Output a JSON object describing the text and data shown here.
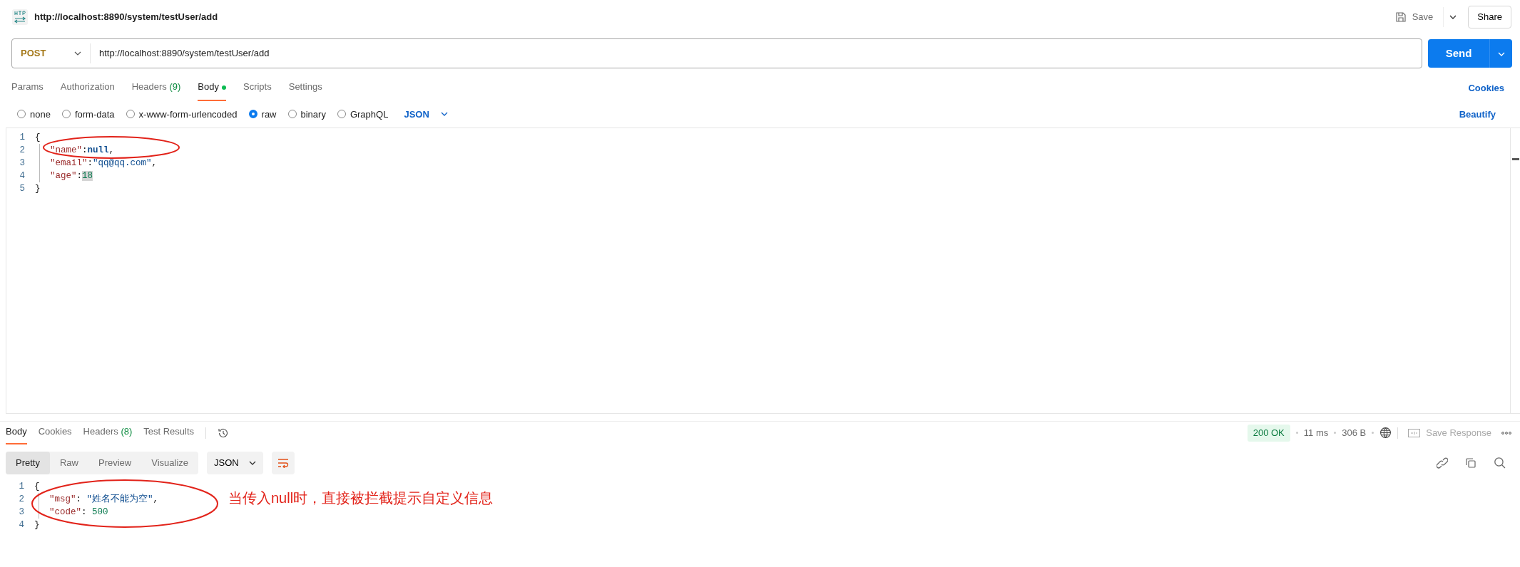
{
  "header": {
    "title": "http://localhost:8890/system/testUser/add",
    "save": "Save",
    "share": "Share"
  },
  "request": {
    "method": "POST",
    "url": "http://localhost:8890/system/testUser/add",
    "send": "Send"
  },
  "request_tabs": [
    {
      "label": "Params",
      "selected": false,
      "dot": false
    },
    {
      "label": "Authorization",
      "selected": false,
      "dot": false
    },
    {
      "label": "Headers",
      "count": "(9)",
      "selected": false,
      "dot": false
    },
    {
      "label": "Body",
      "selected": true,
      "dot": true
    },
    {
      "label": "Scripts",
      "selected": false,
      "dot": false
    },
    {
      "label": "Settings",
      "selected": false,
      "dot": false
    }
  ],
  "cookies_link": "Cookies",
  "body_types": [
    {
      "label": "none",
      "selected": false
    },
    {
      "label": "form-data",
      "selected": false
    },
    {
      "label": "x-www-form-urlencoded",
      "selected": false
    },
    {
      "label": "raw",
      "selected": true
    },
    {
      "label": "binary",
      "selected": false
    },
    {
      "label": "GraphQL",
      "selected": false
    }
  ],
  "raw_format": "JSON",
  "beautify": "Beautify",
  "request_body": [
    {
      "number": "1",
      "tokens": [
        {
          "kind": "punct",
          "text": "{"
        }
      ]
    },
    {
      "number": "2",
      "tokens": [
        {
          "kind": "key",
          "text": "\"name\""
        },
        {
          "kind": "punct",
          "text": ":"
        },
        {
          "kind": "null",
          "text": "null"
        },
        {
          "kind": "punct",
          "text": ","
        }
      ]
    },
    {
      "number": "3",
      "tokens": [
        {
          "kind": "key",
          "text": "\"email\""
        },
        {
          "kind": "punct",
          "text": ":"
        },
        {
          "kind": "string",
          "text": "\"qq@qq.com\""
        },
        {
          "kind": "punct",
          "text": ","
        }
      ]
    },
    {
      "number": "4",
      "tokens": [
        {
          "kind": "key",
          "text": "\"age\""
        },
        {
          "kind": "punct",
          "text": ":"
        },
        {
          "kind": "number",
          "text": "18"
        }
      ]
    },
    {
      "number": "5",
      "tokens": [
        {
          "kind": "punct",
          "text": "}"
        }
      ]
    }
  ],
  "response_tabs": [
    {
      "label": "Body",
      "selected": true
    },
    {
      "label": "Cookies",
      "selected": false
    },
    {
      "label": "Headers",
      "count": "(8)",
      "selected": false
    },
    {
      "label": "Test Results",
      "selected": false
    }
  ],
  "response_status": {
    "status": "200 OK",
    "time": "11 ms",
    "size": "306 B",
    "save_response": "Save Response"
  },
  "view_modes": [
    {
      "label": "Pretty",
      "selected": true
    },
    {
      "label": "Raw",
      "selected": false
    },
    {
      "label": "Preview",
      "selected": false
    },
    {
      "label": "Visualize",
      "selected": false
    }
  ],
  "response_format": "JSON",
  "response_body": [
    {
      "number": "1",
      "tokens": [
        {
          "kind": "punct",
          "text": "{"
        }
      ]
    },
    {
      "number": "2",
      "tokens": [
        {
          "kind": "key",
          "text": "\"msg\""
        },
        {
          "kind": "punct",
          "text": ": "
        },
        {
          "kind": "string",
          "text": "\"姓名不能为空\""
        },
        {
          "kind": "punct",
          "text": ","
        }
      ]
    },
    {
      "number": "3",
      "tokens": [
        {
          "kind": "key",
          "text": "\"code\""
        },
        {
          "kind": "punct",
          "text": ": "
        },
        {
          "kind": "number",
          "text": "500"
        }
      ]
    },
    {
      "number": "4",
      "tokens": [
        {
          "kind": "punct",
          "text": "}"
        }
      ]
    }
  ],
  "annotation": "当传入null时，直接被拦截提示自定义信息"
}
